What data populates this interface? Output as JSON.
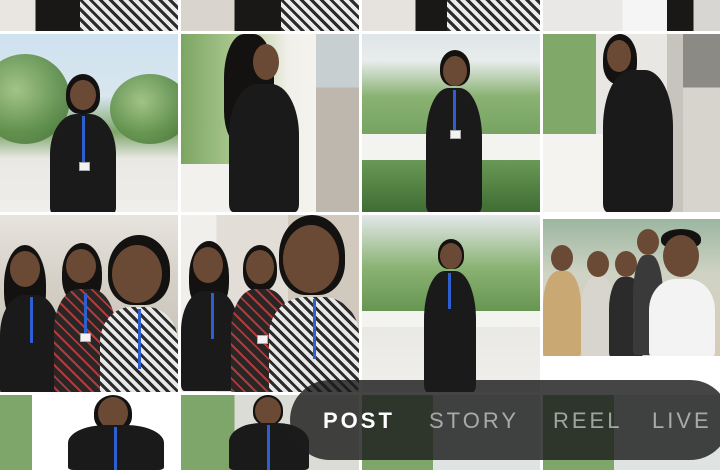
{
  "gallery": {
    "photos": [
      {
        "id": "r0c0"
      },
      {
        "id": "r0c1"
      },
      {
        "id": "r0c2"
      },
      {
        "id": "r0c3"
      },
      {
        "id": "r1c0"
      },
      {
        "id": "r1c1"
      },
      {
        "id": "r1c2"
      },
      {
        "id": "r1c3"
      },
      {
        "id": "r2c0"
      },
      {
        "id": "r2c1"
      },
      {
        "id": "r2c2"
      },
      {
        "id": "r2c3"
      },
      {
        "id": "r3c0"
      },
      {
        "id": "r3c1"
      },
      {
        "id": "r3c2"
      },
      {
        "id": "r3c3"
      }
    ]
  },
  "mode_selector": {
    "items": [
      "POST",
      "STORY",
      "REEL",
      "LIVE"
    ],
    "active": "POST"
  },
  "colors": {
    "accent": "#ffffff",
    "inactive": "#bdbdbd",
    "bar": "#1c1c1c"
  }
}
